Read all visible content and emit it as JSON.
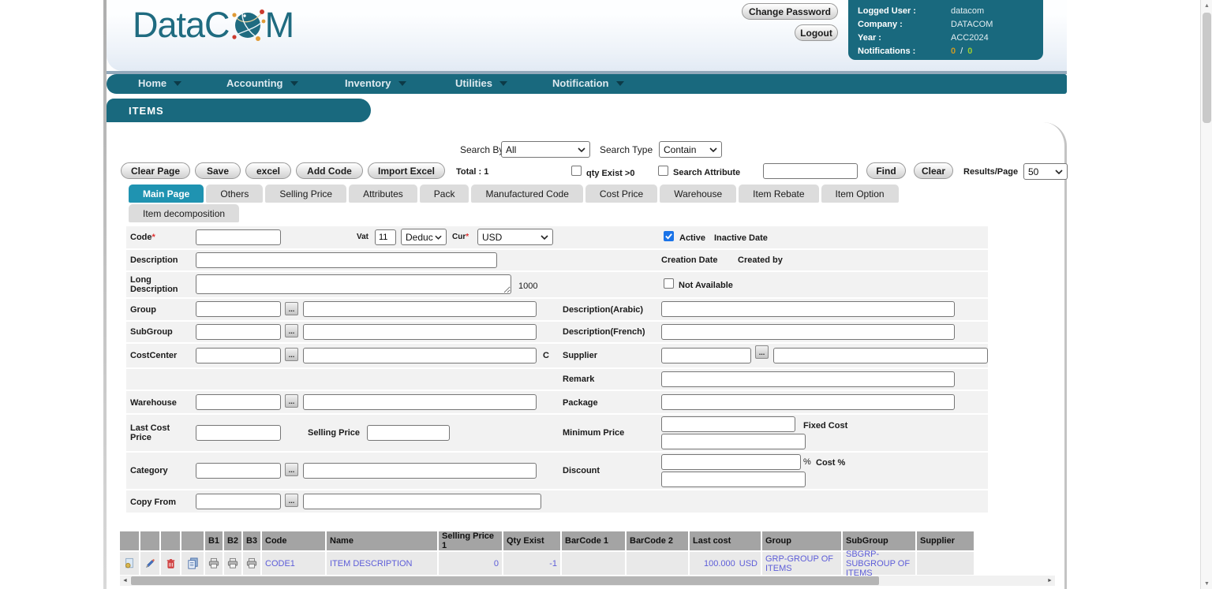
{
  "header": {
    "logo_part1": "DataC",
    "logo_part2": "M",
    "change_password_label": "Change Password",
    "logout_label": "Logout",
    "user": {
      "logged_user_label": "Logged User :",
      "logged_user_value": "datacom",
      "company_label": "Company :",
      "company_value": "DATACOM",
      "year_label": "Year :",
      "year_value": "ACC2024",
      "notifications_label": "Notifications :",
      "notifications_value_1": "0",
      "notifications_separator": "/",
      "notifications_value_2": "0"
    }
  },
  "nav": {
    "items": [
      "Home",
      "Accounting",
      "Inventory",
      "Utilities",
      "Notification"
    ]
  },
  "page_title": "ITEMS",
  "toolbar": {
    "clear_page_label": "Clear Page",
    "save_label": "Save",
    "excel_label": "excel",
    "add_code_label": "Add Code",
    "import_excel_label": "Import Excel",
    "total_label": "Total : 1"
  },
  "search": {
    "search_by_label": "Search By",
    "search_by_value": "All",
    "search_type_label": "Search Type",
    "search_type_value": "Contain",
    "qty_exist_label": "qty Exist >0",
    "search_attribute_label": "Search Attribute",
    "search_input_value": "",
    "find_label": "Find",
    "clear_label": "Clear",
    "results_per_page_label": "Results/Page",
    "results_per_page_value": "50"
  },
  "tabs": {
    "items": [
      "Main Page",
      "Others",
      "Selling Price",
      "Attributes",
      "Pack",
      "Manufactured Code",
      "Cost Price",
      "Warehouse",
      "Item Rebate",
      "Item Option",
      "Item decomposition"
    ],
    "active": "Main Page"
  },
  "form": {
    "required_marker": "*",
    "code_label": "Code",
    "vat_label": "Vat",
    "vat_value": "11",
    "vat_type_value": "Deduc",
    "cur_label": "Cur",
    "cur_value": "USD",
    "active_label": "Active",
    "inactive_date_label": "Inactive Date",
    "description_label": "Description",
    "creation_date_label": "Creation Date",
    "created_by_label": "Created by",
    "long_description_label": "Long Description",
    "long_description_limit": "1000",
    "not_available_label": "Not Available",
    "group_label": "Group",
    "description_arabic_label": "Description(Arabic)",
    "subgroup_label": "SubGroup",
    "description_french_label": "Description(French)",
    "costcenter_label": "CostCenter",
    "c_label": "C",
    "supplier_label": "Supplier",
    "remark_label": "Remark",
    "warehouse_label": "Warehouse",
    "package_label": "Package",
    "last_cost_price_label": "Last Cost Price",
    "selling_price_label": "Selling Price",
    "minimum_price_label": "Minimum Price",
    "fixed_cost_label": "Fixed Cost",
    "category_label": "Category",
    "discount_label": "Discount",
    "percent_label": "%",
    "cost_percent_label": "Cost %",
    "copy_from_label": "Copy From"
  },
  "table": {
    "headers": {
      "b1": "B1",
      "b2": "B2",
      "b3": "B3",
      "code": "Code",
      "name": "Name",
      "selling_price_1": "Selling Price 1",
      "qty_exist": "Qty Exist",
      "barcode_1": "BarCode 1",
      "barcode_2": "BarCode 2",
      "last_cost": "Last cost",
      "group": "Group",
      "subgroup": "SubGroup",
      "supplier": "Supplier"
    },
    "row": {
      "code": "CODE1",
      "name": "ITEM DESCRIPTION",
      "selling_price_1": "0",
      "qty_exist": "-1",
      "barcode_1": "",
      "barcode_2": "",
      "last_cost": "100.000",
      "last_cost_currency": "USD",
      "group": "GRP-GROUP OF ITEMS",
      "subgroup": "SBGRP-SUBGROUP OF ITEMS",
      "supplier": ""
    }
  },
  "icons": {
    "browse": "...",
    "scroll_left": "◄",
    "scroll_right": "►",
    "scroll_up": "▲",
    "scroll_down": "▼"
  },
  "colors": {
    "teal": "#19697e",
    "active_tab": "#1f93b1",
    "link": "#5d5dd8",
    "notification_left": "#c89a28",
    "notification_right": "#9acd32"
  }
}
